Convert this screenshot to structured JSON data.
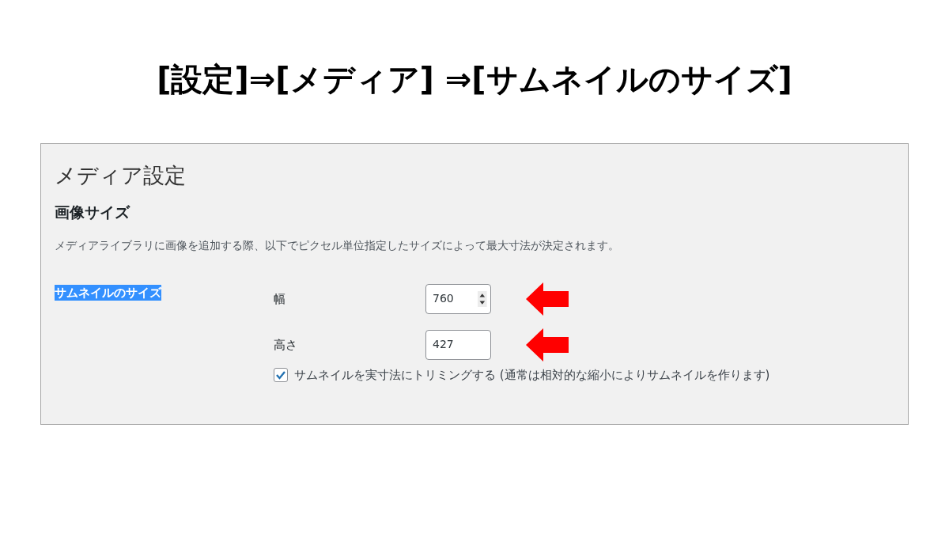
{
  "slide_title": "[設定]⇒[メディア] ⇒[サムネイルのサイズ]",
  "panel": {
    "title": "メディア設定",
    "section_heading": "画像サイズ",
    "description": "メディアライブラリに画像を追加する際、以下でピクセル単位指定したサイズによって最大寸法が決定されます。",
    "setting_label": {
      "text": "サムネイルのサイズ",
      "highlighted": true
    },
    "fields": [
      {
        "label": "幅",
        "value": "760",
        "kind": "number",
        "annotated": true
      },
      {
        "label": "高さ",
        "value": "427",
        "kind": "text",
        "annotated": true
      }
    ],
    "checkbox": {
      "label": "サムネイルを実寸法にトリミングする (通常は相対的な縮小によりサムネイルを作ります)",
      "checked": true
    }
  }
}
